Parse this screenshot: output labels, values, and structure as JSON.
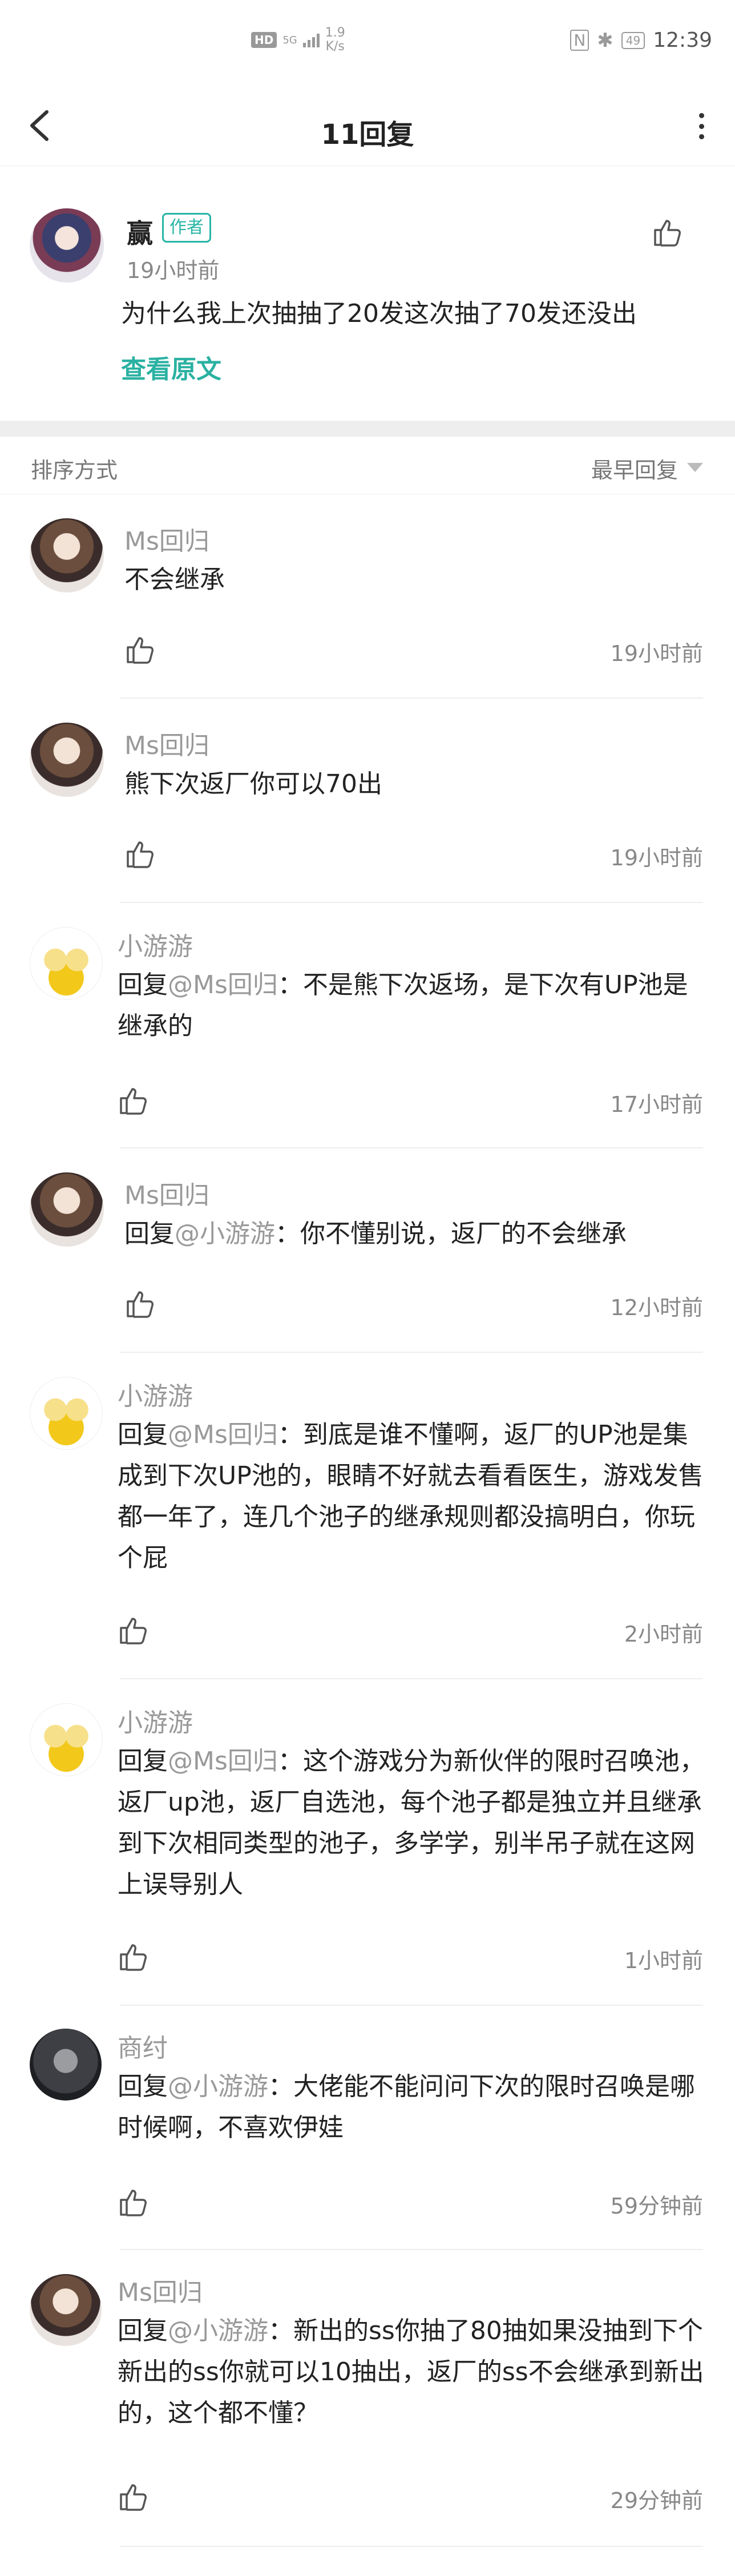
{
  "status_bar": {
    "hd": "HD",
    "net": "5G",
    "speed_value": "1.9",
    "speed_unit": "K/s",
    "nfc": "N",
    "battery": "49",
    "time": "12:39"
  },
  "header": {
    "title": "11回复"
  },
  "main_post": {
    "author": "赢",
    "badge": "作者",
    "time": "19小时前",
    "text": "为什么我上次抽抽了20发这次抽了70发还没出",
    "view_original": "查看原文"
  },
  "sort": {
    "label": "排序方式",
    "value": "最早回复"
  },
  "replies": [
    {
      "user": "Ms回归",
      "prefix": "",
      "at": "",
      "text": "不会继承",
      "time": "19小时前"
    },
    {
      "user": "Ms回归",
      "prefix": "",
      "at": "",
      "text": "熊下次返厂你可以70出",
      "time": "19小时前"
    },
    {
      "user": "小游游",
      "prefix": "回复",
      "at": "@Ms回归",
      "text": "：不是熊下次返场，是下次有UP池是继承的",
      "time": "17小时前"
    },
    {
      "user": "Ms回归",
      "prefix": "回复",
      "at": "@小游游",
      "text": "：你不懂别说，返厂的不会继承",
      "time": "12小时前"
    },
    {
      "user": "小游游",
      "prefix": "回复",
      "at": "@Ms回归",
      "text": "：到底是谁不懂啊，返厂的UP池是集成到下次UP池的，眼睛不好就去看看医生，游戏发售都一年了，连几个池子的继承规则都没搞明白，你玩个屁",
      "time": "2小时前"
    },
    {
      "user": "小游游",
      "prefix": "回复",
      "at": "@Ms回归",
      "text": "：这个游戏分为新伙伴的限时召唤池，返厂up池，返厂自选池，每个池子都是独立并且继承到下次相同类型的池子，多学学，别半吊子就在这网上误导别人",
      "time": "1小时前"
    },
    {
      "user": "商纣",
      "prefix": "回复",
      "at": "@小游游",
      "text": "：大佬能不能问问下次的限时召唤是哪时候啊，不喜欢伊娃",
      "time": "59分钟前"
    },
    {
      "user": "Ms回归",
      "prefix": "回复",
      "at": "@小游游",
      "text": "：新出的ss你抽了80抽如果没抽到下个新出的ss你就可以10抽出，返厂的ss不会继承到新出的，这个都不懂？",
      "time": "29分钟前"
    }
  ],
  "icons": {
    "back": "back-arrow-icon",
    "menu": "more-vertical-icon",
    "like": "thumb-up-icon"
  }
}
